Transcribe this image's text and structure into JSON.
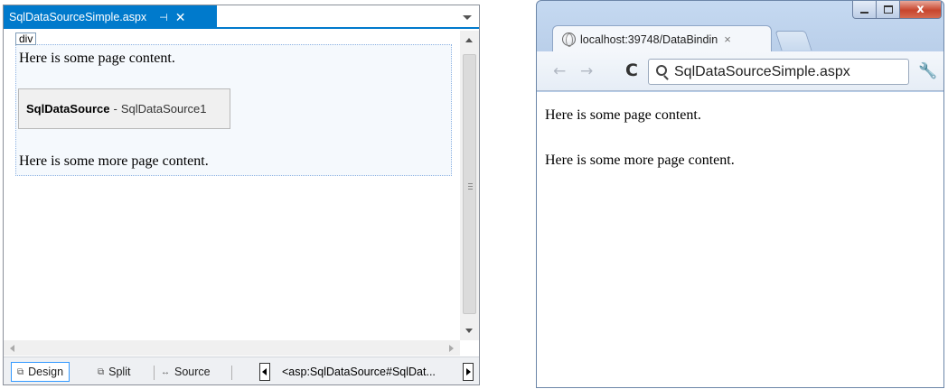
{
  "vs_designer": {
    "tab": {
      "title": "SqlDataSourceSimple.aspx",
      "pin_glyph": "⊣",
      "close_glyph": "✕",
      "active_color": "#007acc"
    },
    "div_tag": "div",
    "content": {
      "line1": "Here is some page content.",
      "control_type": "SqlDataSource",
      "control_separator": "-",
      "control_id": "SqlDataSource1",
      "line2": "Here is some more page content."
    },
    "bottom_bar": {
      "design_label": "Design",
      "split_label": "Split",
      "source_label": "Source",
      "design_icon": "⧉",
      "split_icon": "⧉",
      "source_icon": "↔",
      "breadcrumb": "<asp:SqlDataSource#SqlDat..."
    }
  },
  "browser": {
    "tab_title": "localhost:39748/DataBindin",
    "tab_close": "×",
    "omnibox_text": "SqlDataSourceSimple.aspx",
    "back_glyph": "←",
    "forward_glyph": "→",
    "reload_glyph": "C",
    "wrench_glyph": "🔧",
    "close_glyph": "x",
    "content": {
      "line1": "Here is some page content.",
      "line2": "Here is some more page content."
    }
  }
}
